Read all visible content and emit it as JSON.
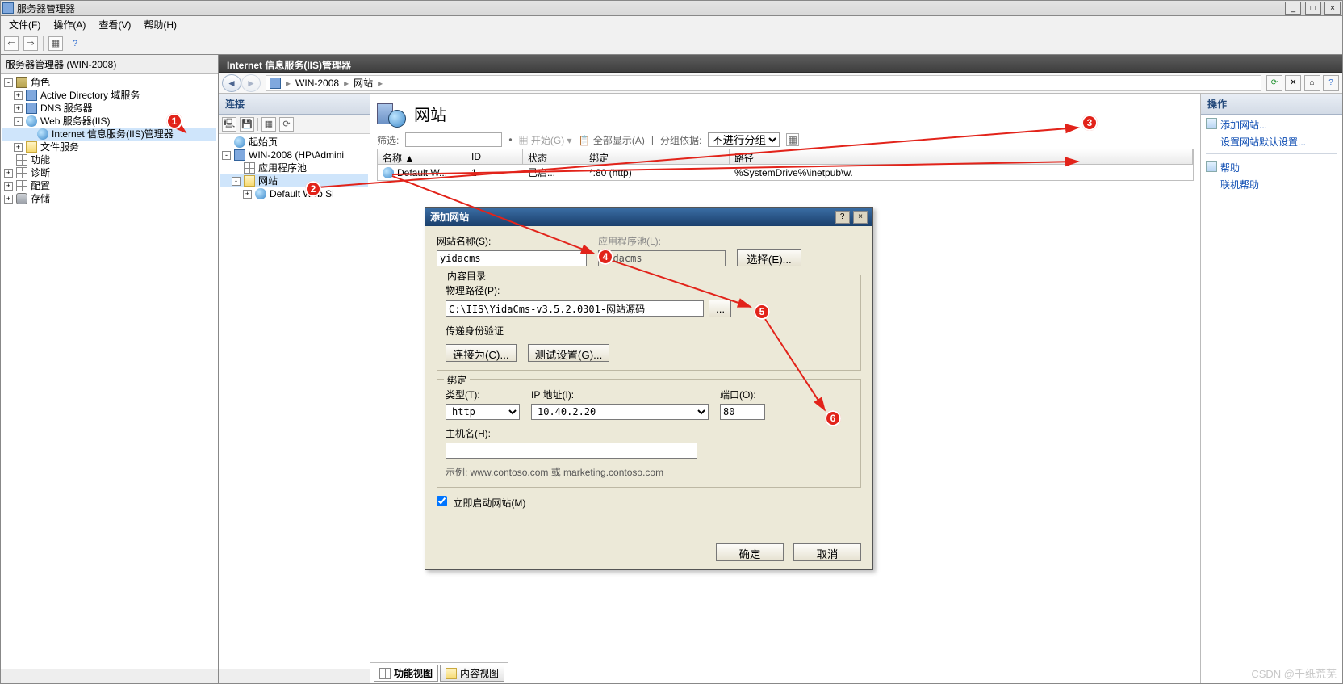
{
  "window": {
    "title": "服务器管理器",
    "menus": [
      "文件(F)",
      "操作(A)",
      "查看(V)",
      "帮助(H)"
    ]
  },
  "leftTree": {
    "header": "服务器管理器 (WIN-2008)",
    "items": [
      {
        "label": "角色"
      },
      {
        "label": "Active Directory 域服务"
      },
      {
        "label": "DNS 服务器"
      },
      {
        "label": "Web 服务器(IIS)"
      },
      {
        "label": "Internet 信息服务(IIS)管理器"
      },
      {
        "label": "文件服务"
      },
      {
        "label": "功能"
      },
      {
        "label": "诊断"
      },
      {
        "label": "配置"
      },
      {
        "label": "存储"
      }
    ]
  },
  "iis": {
    "title": "Internet 信息服务(IIS)管理器",
    "crumb": [
      "WIN-2008",
      "网站"
    ],
    "connectionsHeader": "连接",
    "connTree": {
      "start": "起始页",
      "server": "WIN-2008 (HP\\Admini",
      "apppool": "应用程序池",
      "sites": "网站",
      "default": "Default Web Si"
    },
    "pageTitle": "网站",
    "filterLabel": "筛选:",
    "startLabel": "开始(G)",
    "showAll": "全部显示(A)",
    "groupByLabel": "分组依据:",
    "groupBySel": "不进行分组",
    "columns": {
      "name": "名称 ▲",
      "id": "ID",
      "state": "状态",
      "bind": "绑定",
      "path": "路径"
    },
    "row": {
      "name": "Default W...",
      "id": "1",
      "state": "已启...",
      "bind": "*:80 (http)",
      "path": "%SystemDrive%\\inetpub\\w."
    },
    "tabFeature": "功能视图",
    "tabContent": "内容视图"
  },
  "actions": {
    "header": "操作",
    "add": "添加网站...",
    "defaults": "设置网站默认设置...",
    "help": "帮助",
    "online": "联机帮助"
  },
  "dialog": {
    "title": "添加网站",
    "siteNameLabel": "网站名称(S):",
    "siteName": "yidacms",
    "appPoolLabel": "应用程序池(L):",
    "appPool": "yidacms",
    "selectBtn": "选择(E)...",
    "contentGroup": "内容目录",
    "physPathLabel": "物理路径(P):",
    "physPath": "C:\\IIS\\YidaCms-v3.5.2.0301-网站源码",
    "browse": "...",
    "passthroughLabel": "传递身份验证",
    "connectAs": "连接为(C)...",
    "testSettings": "测试设置(G)...",
    "bindGroup": "绑定",
    "typeLabel": "类型(T):",
    "type": "http",
    "ipLabel": "IP 地址(I):",
    "ip": "10.40.2.20",
    "portLabel": "端口(O):",
    "port": "80",
    "hostLabel": "主机名(H):",
    "host": "",
    "example": "示例: www.contoso.com 或 marketing.contoso.com",
    "autostart": "立即启动网站(M)",
    "ok": "确定",
    "cancel": "取消"
  },
  "annotations": [
    "1",
    "2",
    "3",
    "4",
    "5",
    "6"
  ],
  "watermark": "CSDN @千纸荒芜"
}
